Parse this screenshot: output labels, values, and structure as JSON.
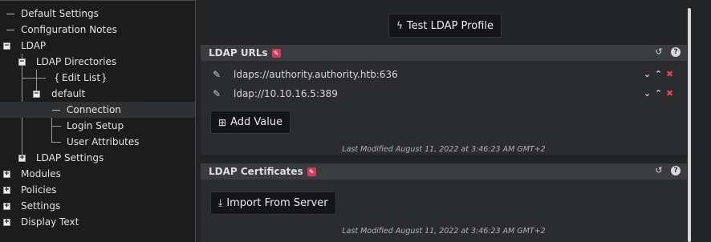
{
  "tree": {
    "items": [
      {
        "label": "Default Settings"
      },
      {
        "label": "Configuration Notes"
      },
      {
        "label": "LDAP"
      },
      {
        "label": "LDAP Directories"
      },
      {
        "label": "Edit List"
      },
      {
        "label": "default"
      },
      {
        "label": "Connection"
      },
      {
        "label": "Login Setup"
      },
      {
        "label": "User Attributes"
      },
      {
        "label": "LDAP Settings"
      },
      {
        "label": "Modules"
      },
      {
        "label": "Policies"
      },
      {
        "label": "Settings"
      },
      {
        "label": "Display Text"
      }
    ],
    "edit_list_open": "{",
    "edit_list_close": "}",
    "expand_symbol": "+",
    "collapse_symbol": "−",
    "selected": "Connection"
  },
  "toolbar": {
    "test_button_label": "Test LDAP Profile"
  },
  "ldap_urls": {
    "title": "LDAP URLs",
    "values": [
      {
        "url": "ldaps://authority.authority.htb:636"
      },
      {
        "url": "ldap://10.10.16.5:389"
      }
    ],
    "add_button_label": "Add Value",
    "last_modified": "Last Modified August 11, 2022 at 3:46:23 AM GMT+2"
  },
  "ldap_certificates": {
    "title": "LDAP Certificates",
    "import_button_label": "Import From Server",
    "last_modified": "Last Modified August 11, 2022 at 3:46:23 AM GMT+2"
  },
  "icons": {
    "test": "bolt-icon",
    "edit": "pencil-icon",
    "reset": "undo-icon",
    "help": "help-icon",
    "move_down": "chevron-down-icon",
    "move_up": "chevron-up-icon",
    "delete": "close-icon",
    "add": "plus-square-icon",
    "import": "download-icon"
  },
  "colors": {
    "edit_badge": "#d23a5e",
    "delete": "#e04848",
    "panel_header": "#3a3c3f",
    "button": "#141518"
  }
}
